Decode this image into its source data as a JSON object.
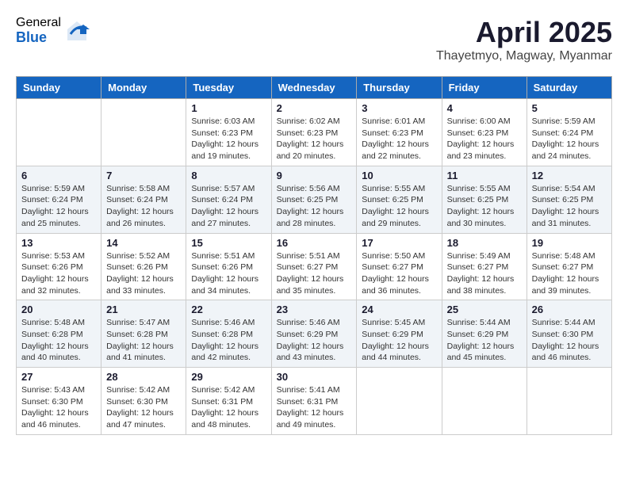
{
  "header": {
    "logo": {
      "general": "General",
      "blue": "Blue"
    },
    "title": "April 2025",
    "location": "Thayetmyo, Magway, Myanmar"
  },
  "days_of_week": [
    "Sunday",
    "Monday",
    "Tuesday",
    "Wednesday",
    "Thursday",
    "Friday",
    "Saturday"
  ],
  "weeks": [
    [
      {
        "day": "",
        "sunrise": "",
        "sunset": "",
        "daylight": "",
        "empty": true
      },
      {
        "day": "",
        "sunrise": "",
        "sunset": "",
        "daylight": "",
        "empty": true
      },
      {
        "day": "1",
        "sunrise": "Sunrise: 6:03 AM",
        "sunset": "Sunset: 6:23 PM",
        "daylight": "Daylight: 12 hours and 19 minutes."
      },
      {
        "day": "2",
        "sunrise": "Sunrise: 6:02 AM",
        "sunset": "Sunset: 6:23 PM",
        "daylight": "Daylight: 12 hours and 20 minutes."
      },
      {
        "day": "3",
        "sunrise": "Sunrise: 6:01 AM",
        "sunset": "Sunset: 6:23 PM",
        "daylight": "Daylight: 12 hours and 22 minutes."
      },
      {
        "day": "4",
        "sunrise": "Sunrise: 6:00 AM",
        "sunset": "Sunset: 6:23 PM",
        "daylight": "Daylight: 12 hours and 23 minutes."
      },
      {
        "day": "5",
        "sunrise": "Sunrise: 5:59 AM",
        "sunset": "Sunset: 6:24 PM",
        "daylight": "Daylight: 12 hours and 24 minutes."
      }
    ],
    [
      {
        "day": "6",
        "sunrise": "Sunrise: 5:59 AM",
        "sunset": "Sunset: 6:24 PM",
        "daylight": "Daylight: 12 hours and 25 minutes."
      },
      {
        "day": "7",
        "sunrise": "Sunrise: 5:58 AM",
        "sunset": "Sunset: 6:24 PM",
        "daylight": "Daylight: 12 hours and 26 minutes."
      },
      {
        "day": "8",
        "sunrise": "Sunrise: 5:57 AM",
        "sunset": "Sunset: 6:24 PM",
        "daylight": "Daylight: 12 hours and 27 minutes."
      },
      {
        "day": "9",
        "sunrise": "Sunrise: 5:56 AM",
        "sunset": "Sunset: 6:25 PM",
        "daylight": "Daylight: 12 hours and 28 minutes."
      },
      {
        "day": "10",
        "sunrise": "Sunrise: 5:55 AM",
        "sunset": "Sunset: 6:25 PM",
        "daylight": "Daylight: 12 hours and 29 minutes."
      },
      {
        "day": "11",
        "sunrise": "Sunrise: 5:55 AM",
        "sunset": "Sunset: 6:25 PM",
        "daylight": "Daylight: 12 hours and 30 minutes."
      },
      {
        "day": "12",
        "sunrise": "Sunrise: 5:54 AM",
        "sunset": "Sunset: 6:25 PM",
        "daylight": "Daylight: 12 hours and 31 minutes."
      }
    ],
    [
      {
        "day": "13",
        "sunrise": "Sunrise: 5:53 AM",
        "sunset": "Sunset: 6:26 PM",
        "daylight": "Daylight: 12 hours and 32 minutes."
      },
      {
        "day": "14",
        "sunrise": "Sunrise: 5:52 AM",
        "sunset": "Sunset: 6:26 PM",
        "daylight": "Daylight: 12 hours and 33 minutes."
      },
      {
        "day": "15",
        "sunrise": "Sunrise: 5:51 AM",
        "sunset": "Sunset: 6:26 PM",
        "daylight": "Daylight: 12 hours and 34 minutes."
      },
      {
        "day": "16",
        "sunrise": "Sunrise: 5:51 AM",
        "sunset": "Sunset: 6:27 PM",
        "daylight": "Daylight: 12 hours and 35 minutes."
      },
      {
        "day": "17",
        "sunrise": "Sunrise: 5:50 AM",
        "sunset": "Sunset: 6:27 PM",
        "daylight": "Daylight: 12 hours and 36 minutes."
      },
      {
        "day": "18",
        "sunrise": "Sunrise: 5:49 AM",
        "sunset": "Sunset: 6:27 PM",
        "daylight": "Daylight: 12 hours and 38 minutes."
      },
      {
        "day": "19",
        "sunrise": "Sunrise: 5:48 AM",
        "sunset": "Sunset: 6:27 PM",
        "daylight": "Daylight: 12 hours and 39 minutes."
      }
    ],
    [
      {
        "day": "20",
        "sunrise": "Sunrise: 5:48 AM",
        "sunset": "Sunset: 6:28 PM",
        "daylight": "Daylight: 12 hours and 40 minutes."
      },
      {
        "day": "21",
        "sunrise": "Sunrise: 5:47 AM",
        "sunset": "Sunset: 6:28 PM",
        "daylight": "Daylight: 12 hours and 41 minutes."
      },
      {
        "day": "22",
        "sunrise": "Sunrise: 5:46 AM",
        "sunset": "Sunset: 6:28 PM",
        "daylight": "Daylight: 12 hours and 42 minutes."
      },
      {
        "day": "23",
        "sunrise": "Sunrise: 5:46 AM",
        "sunset": "Sunset: 6:29 PM",
        "daylight": "Daylight: 12 hours and 43 minutes."
      },
      {
        "day": "24",
        "sunrise": "Sunrise: 5:45 AM",
        "sunset": "Sunset: 6:29 PM",
        "daylight": "Daylight: 12 hours and 44 minutes."
      },
      {
        "day": "25",
        "sunrise": "Sunrise: 5:44 AM",
        "sunset": "Sunset: 6:29 PM",
        "daylight": "Daylight: 12 hours and 45 minutes."
      },
      {
        "day": "26",
        "sunrise": "Sunrise: 5:44 AM",
        "sunset": "Sunset: 6:30 PM",
        "daylight": "Daylight: 12 hours and 46 minutes."
      }
    ],
    [
      {
        "day": "27",
        "sunrise": "Sunrise: 5:43 AM",
        "sunset": "Sunset: 6:30 PM",
        "daylight": "Daylight: 12 hours and 46 minutes."
      },
      {
        "day": "28",
        "sunrise": "Sunrise: 5:42 AM",
        "sunset": "Sunset: 6:30 PM",
        "daylight": "Daylight: 12 hours and 47 minutes."
      },
      {
        "day": "29",
        "sunrise": "Sunrise: 5:42 AM",
        "sunset": "Sunset: 6:31 PM",
        "daylight": "Daylight: 12 hours and 48 minutes."
      },
      {
        "day": "30",
        "sunrise": "Sunrise: 5:41 AM",
        "sunset": "Sunset: 6:31 PM",
        "daylight": "Daylight: 12 hours and 49 minutes."
      },
      {
        "day": "",
        "sunrise": "",
        "sunset": "",
        "daylight": "",
        "empty": true
      },
      {
        "day": "",
        "sunrise": "",
        "sunset": "",
        "daylight": "",
        "empty": true
      },
      {
        "day": "",
        "sunrise": "",
        "sunset": "",
        "daylight": "",
        "empty": true
      }
    ]
  ]
}
